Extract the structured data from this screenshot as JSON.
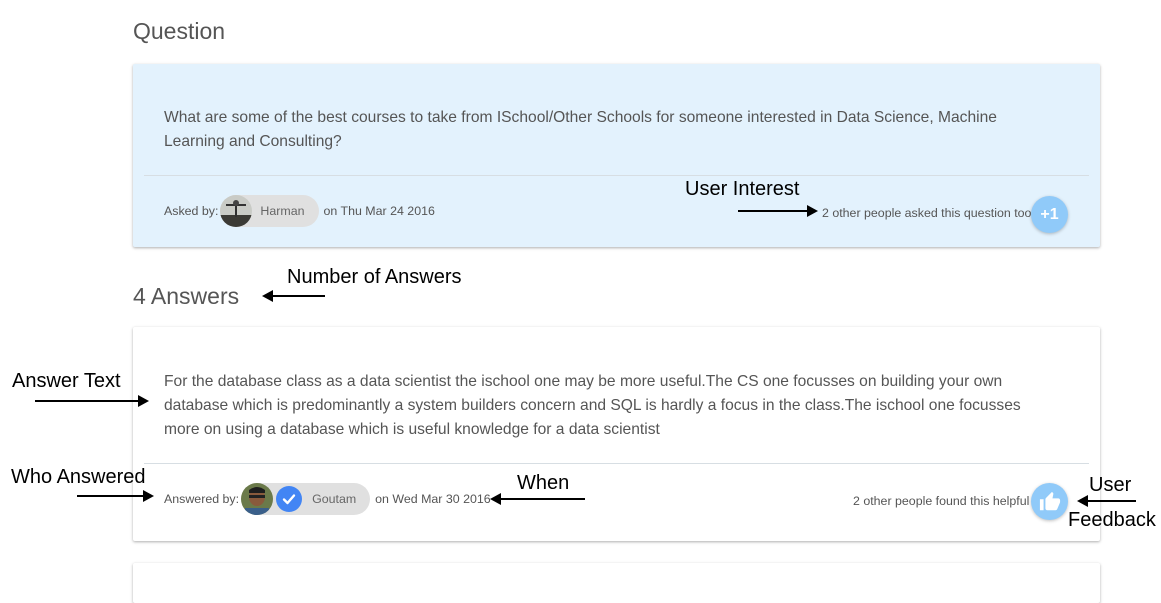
{
  "question_section": {
    "heading": "Question",
    "text": "What are some of the best courses to take from ISchool/Other Schools for someone interested in Data Science, Machine Learning and Consulting?",
    "asked_by_label": "Asked by:",
    "author": "Harman",
    "date": "on Thu Mar 24 2016",
    "interest_text": "2 other people asked this question too",
    "plus_one_label": "+1"
  },
  "answers_section": {
    "heading": "4 Answers",
    "answers": [
      {
        "text": "For the database class as a data scientist the ischool one may be more useful.The CS one focusses on building your own database which is predominantly a system builders concern and SQL is hardly a focus in the class.The ischool one focusses more on using a database which is useful knowledge for a data scientist",
        "answered_by_label": "Answered by:",
        "author": "Goutam",
        "date": "on Wed Mar 30 2016",
        "helpful_text": "2 other people found this helpful"
      }
    ]
  },
  "annotations": {
    "user_interest": "User Interest",
    "number_of_answers": "Number of Answers",
    "answer_text": "Answer Text",
    "who_answered": "Who Answered",
    "when": "When",
    "user_feedback_line1": "User",
    "user_feedback_line2": "Feedback"
  },
  "colors": {
    "question_card_bg": "#e3f2fd",
    "chip_bg": "#e0e0e0",
    "fab_bg": "#90caf9",
    "verified_badge": "#4285f4"
  },
  "icons": {
    "plus_one_button": "plus-one",
    "helpful_button": "thumbs-up-icon",
    "verified_badge": "check-icon"
  }
}
